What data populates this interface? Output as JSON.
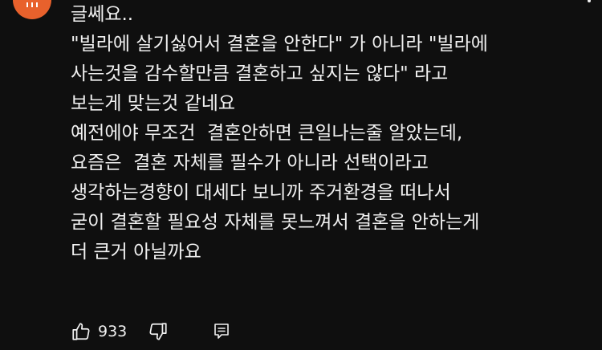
{
  "comment": {
    "lines": [
      "글쎄요..",
      "\"빌라에 살기싫어서 결혼을 안한다\" 가 아니라 \"빌라에",
      "사는것을 감수할만큼 결혼하고 싶지는 않다\" 라고",
      "보는게 맞는것 같네요",
      "예전에야 무조건  결혼안하면 큰일나는줄 알았는데,",
      "요즘은  결혼 자체를 필수가 아니라 선택이라고",
      "생각하는경향이 대세다 보니까 주거환경을 떠나서",
      "굳이 결혼할 필요성 자체를 못느껴서 결혼을 안하는게",
      "더 큰거 아닐까요"
    ]
  },
  "actions": {
    "like_count": "933",
    "like_icon": "thumbs-up-icon",
    "dislike_icon": "thumbs-down-icon",
    "reply_icon": "reply-comment-icon"
  },
  "avatar": {
    "color": "#e8612c"
  },
  "menu_icon": "more-vertical-icon"
}
